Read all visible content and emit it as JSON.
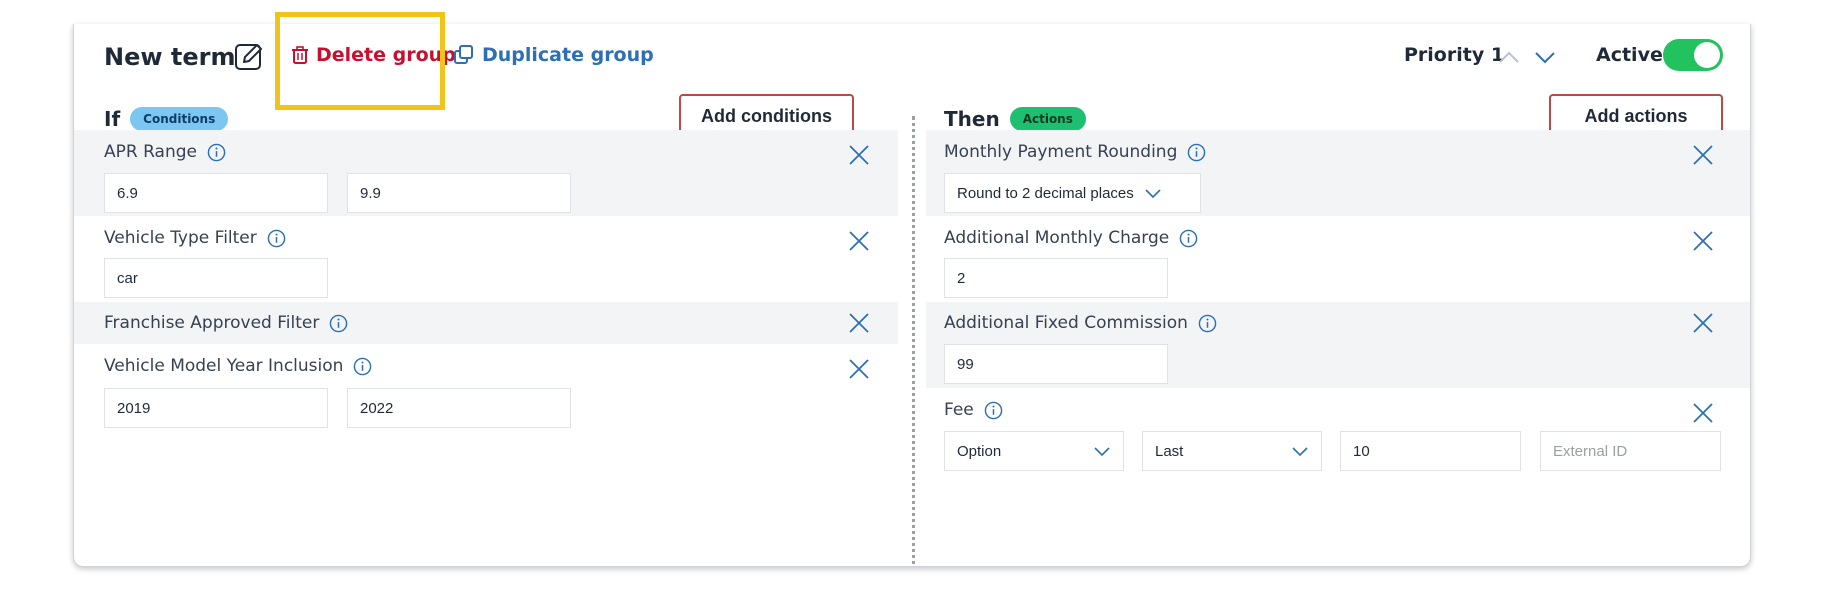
{
  "header": {
    "title": "New term",
    "delete_label": "Delete group",
    "duplicate_label": "Duplicate group",
    "priority_label": "Priority 1",
    "active_label": "Active",
    "active": true
  },
  "colors": {
    "accent_green": "#22c25f",
    "delete_red": "#c8102e",
    "link_blue": "#2c6fb6",
    "highlight": "#f0c419"
  },
  "if_panel": {
    "label": "If",
    "badge": "Conditions",
    "add_label": "Add conditions",
    "conditions": [
      {
        "label": "APR Range",
        "values": [
          "6.9",
          "9.9"
        ]
      },
      {
        "label": "Vehicle Type Filter",
        "values": [
          "car"
        ]
      },
      {
        "label": "Franchise Approved Filter",
        "values": []
      },
      {
        "label": "Vehicle Model Year Inclusion",
        "values": [
          "2019",
          "2022"
        ]
      }
    ]
  },
  "then_panel": {
    "label": "Then",
    "badge": "Actions",
    "add_label": "Add actions",
    "actions": [
      {
        "label": "Monthly Payment Rounding",
        "select_value": "Round to 2 decimal places"
      },
      {
        "label": "Additional Monthly Charge",
        "value": "2"
      },
      {
        "label": "Additional Fixed Commission",
        "value": "99"
      },
      {
        "label": "Fee",
        "option_value": "Option",
        "last_value": "Last",
        "amount": "10",
        "external_id_placeholder": "External ID"
      }
    ]
  },
  "icons": {
    "edit": "pencil-square-icon",
    "delete": "trash-icon",
    "duplicate": "duplicate-icon",
    "info": "info-icon",
    "remove": "close-icon",
    "chevron_up": "chevron-up-icon",
    "chevron_down": "chevron-down-icon"
  }
}
